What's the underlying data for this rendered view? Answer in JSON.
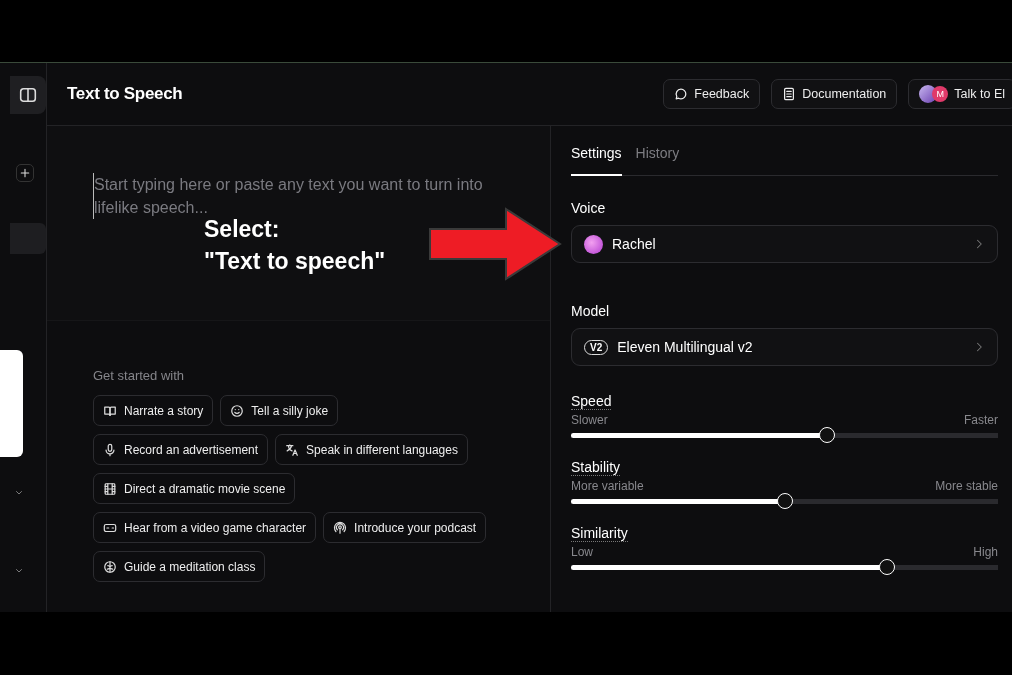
{
  "header": {
    "title": "Text to Speech",
    "buttons": [
      {
        "kind": "feedback",
        "label": "Feedback"
      },
      {
        "kind": "docs",
        "label": "Documentation"
      },
      {
        "kind": "agent",
        "label": "Talk to El",
        "avatar_letter": "M"
      }
    ]
  },
  "editor": {
    "placeholder": "Start typing here or paste any text you want to turn into lifelike speech..."
  },
  "suggestions": {
    "heading": "Get started with",
    "rows": [
      [
        {
          "kind": "book",
          "label": "Narrate a story"
        },
        {
          "kind": "smile",
          "label": "Tell a silly joke"
        }
      ],
      [
        {
          "kind": "mic",
          "label": "Record an advertisement"
        },
        {
          "kind": "translate",
          "label": "Speak in different languages"
        }
      ],
      [
        {
          "kind": "film",
          "label": "Direct a dramatic movie scene"
        }
      ],
      [
        {
          "kind": "game",
          "label": "Hear from a video game character"
        },
        {
          "kind": "podcast",
          "label": "Introduce your podcast"
        }
      ],
      [
        {
          "kind": "meditate",
          "label": "Guide a meditation class"
        }
      ]
    ]
  },
  "panel": {
    "tabs": [
      {
        "label": "Settings",
        "selected": true
      },
      {
        "label": "History",
        "selected": false
      }
    ],
    "voice": {
      "label": "Voice",
      "value": "Rachel"
    },
    "model": {
      "label": "Model",
      "badge": "V2",
      "value": "Eleven Multilingual v2"
    },
    "sliders": [
      {
        "label": "Speed",
        "min_label": "Slower",
        "max_label": "Faster",
        "level": 0.6
      },
      {
        "label": "Stability",
        "min_label": "More variable",
        "max_label": "More stable",
        "level": 0.5
      },
      {
        "label": "Similarity",
        "min_label": "Low",
        "max_label": "High",
        "level": 0.74
      }
    ]
  },
  "annotation": {
    "lines": [
      "Select:",
      "\"Text to speech\""
    ]
  }
}
